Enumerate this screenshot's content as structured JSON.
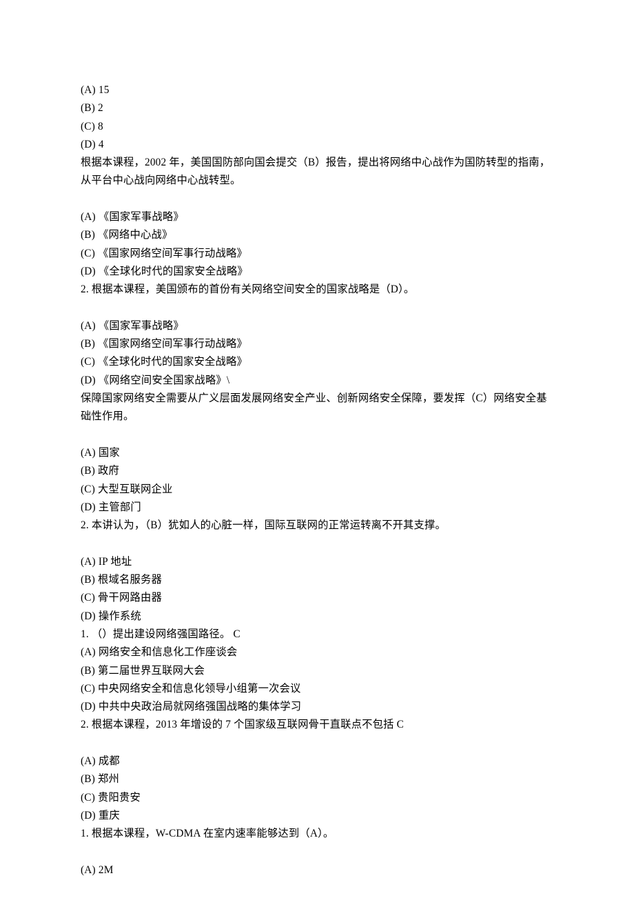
{
  "lines": [
    "(A) 15",
    "(B) 2",
    "(C) 8",
    "(D) 4",
    "根据本课程，2002 年，美国国防部向国会提交（B）报告，提出将网络中心战作为国防转型的指南，从平台中心战向网络中心战转型。",
    "",
    "(A) 《国家军事战略》",
    "(B) 《网络中心战》",
    "(C) 《国家网络空间军事行动战略》",
    "(D) 《全球化时代的国家安全战略》",
    "2. 根据本课程，美国颁布的首份有关网络空间安全的国家战略是（D）。",
    "",
    "(A) 《国家军事战略》",
    "(B) 《国家网络空间军事行动战略》",
    "(C) 《全球化时代的国家安全战略》",
    "(D) 《网络空间安全国家战略》\\",
    "保障国家网络安全需要从广义层面发展网络安全产业、创新网络安全保障，要发挥（C）网络安全基础性作用。",
    "",
    "(A) 国家",
    "(B) 政府",
    "(C) 大型互联网企业",
    "(D) 主管部门",
    "2. 本讲认为，（B）犹如人的心脏一样，国际互联网的正常运转离不开其支撑。",
    "",
    "(A) IP 地址",
    "(B) 根域名服务器",
    "(C) 骨干网路由器",
    "(D) 操作系统",
    "1. （）提出建设网络强国路径。 C",
    "(A) 网络安全和信息化工作座谈会",
    "(B) 第二届世界互联网大会",
    "(C) 中央网络安全和信息化领导小组第一次会议",
    "(D) 中共中央政治局就网络强国战略的集体学习",
    "2. 根据本课程，2013 年增设的 7 个国家级互联网骨干直联点不包括 C",
    "",
    "(A) 成都",
    "(B) 郑州",
    "(C) 贵阳贵安",
    "(D) 重庆",
    "1. 根据本课程，W-CDMA 在室内速率能够达到（A）。",
    "",
    "(A) 2M"
  ]
}
